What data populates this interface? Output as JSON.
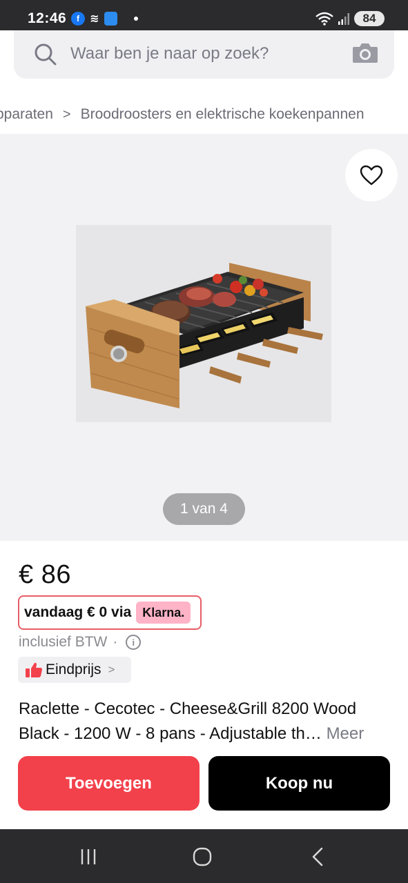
{
  "status_bar": {
    "time": "12:46",
    "battery": "84",
    "icons": [
      "facebook-icon",
      "stack-icon",
      "app-icon",
      "notification-dot",
      "wifi-icon",
      "signal-icon",
      "battery-icon"
    ]
  },
  "search": {
    "placeholder": "Waar ben je naar op zoek?",
    "icon": "search-icon",
    "camera_icon": "camera-icon"
  },
  "breadcrumb": {
    "items": [
      "pparaten",
      "Broodroosters en elektrische koekenpannen"
    ],
    "separator": ">"
  },
  "gallery": {
    "counter": "1 van 4",
    "favorite_icon": "heart-icon"
  },
  "product": {
    "price": "€ 86",
    "klarna_text": "vandaag € 0 via",
    "klarna_badge": "Klarna.",
    "vat_text": "inclusief BTW",
    "vat_dot": "·",
    "final_price_label": "Eindprijs",
    "final_price_chevron": ">",
    "title_line1": "Raclette - Cecotec - Cheese&Grill 8200 Wood",
    "title_line2": "Black - 1200 W - 8 pans - Adjustable th…",
    "more_label": "Meer"
  },
  "actions": {
    "add_label": "Toevoegen",
    "buy_label": "Koop nu"
  },
  "colors": {
    "accent_red": "#f2414b",
    "klarna_pink": "#ffb3c7",
    "klarna_border": "#e85d67",
    "buy_black": "#000000",
    "system_bar": "#2b2b2d"
  }
}
